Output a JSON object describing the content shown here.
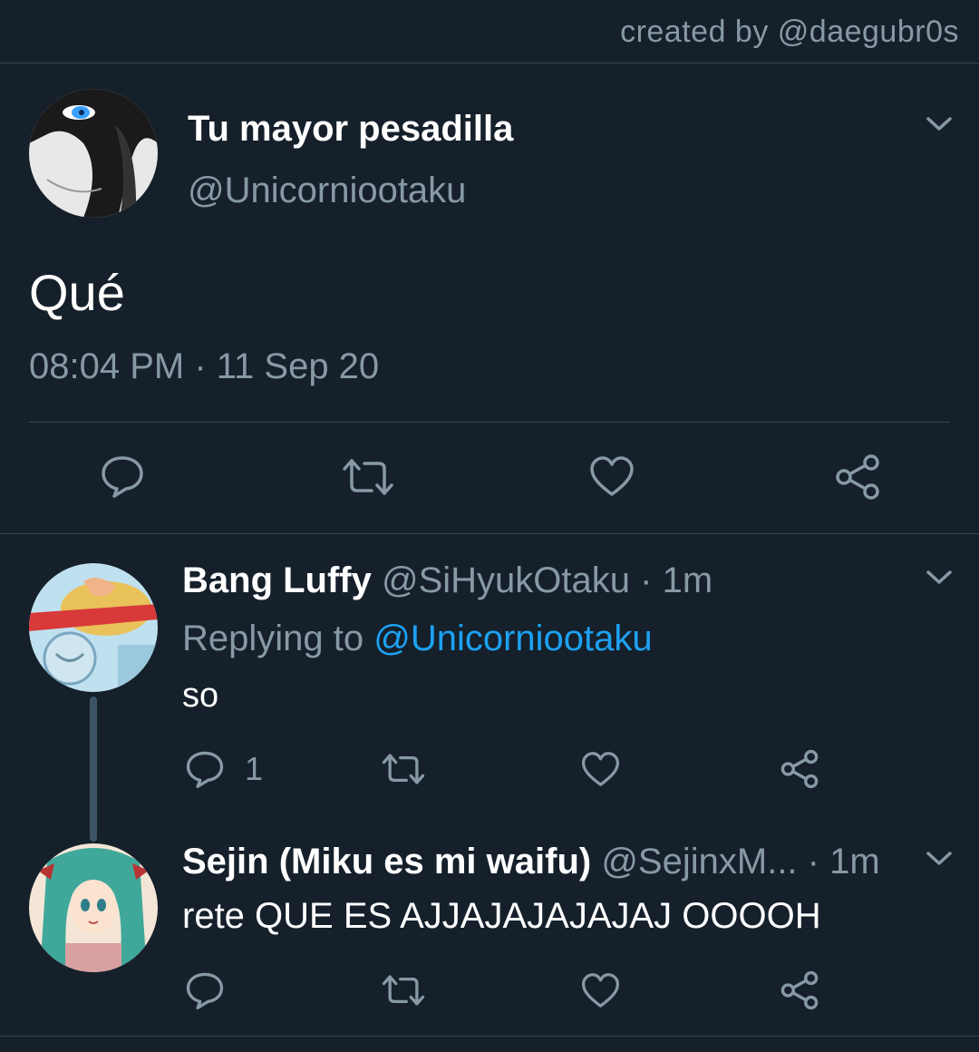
{
  "credit": "created by @daegubr0s",
  "main_tweet": {
    "display_name": "Tu mayor pesadilla",
    "handle": "@Unicorniootaku",
    "text": "Qué",
    "timestamp": "08:04 PM · 11 Sep 20"
  },
  "replies": [
    {
      "display_name": "Bang Luffy",
      "handle_time": "@SiHyukOtaku · 1m",
      "replying_prefix": "Replying to ",
      "replying_to": "@Unicorniootaku",
      "text": "so",
      "reply_count": "1"
    },
    {
      "display_name": "Sejin (Miku es mi waifu)",
      "handle_time": "@SejinxM... · 1m",
      "text": "rete QUE ES AJJAJAJAJAJAJ OOOOH",
      "reply_count": ""
    }
  ],
  "colors": {
    "background": "#15202b",
    "muted_text": "#8899a6",
    "link": "#1da1f2",
    "divider": "#38444d"
  },
  "icons": [
    "reply-icon",
    "retweet-icon",
    "like-icon",
    "share-icon",
    "chevron-down-icon"
  ]
}
